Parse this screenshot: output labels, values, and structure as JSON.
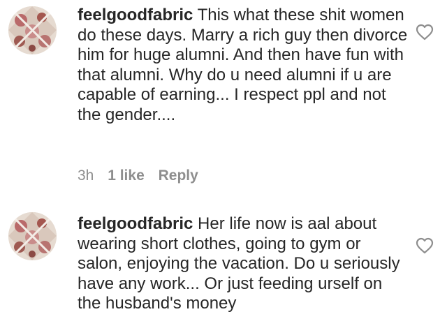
{
  "comments": [
    {
      "username": "feelgoodfabric",
      "text": "This what these shit women do these days. Marry a rich guy then divorce him for huge alumni. And then have fun with that alumni. Why do u need alumni if u are capable of earning... I respect ppl and not the gender....",
      "time": "3h",
      "likes": "1 like",
      "reply_label": "Reply",
      "avatar_icon": "profile-avatar-floral",
      "like_icon": "heart-outline-icon"
    },
    {
      "username": "feelgoodfabric",
      "text": "Her life now is aal about wearing short clothes, going to gym or salon, enjoying the vacation. Do u seriously have any work... Or just feeding urself on the husband's money",
      "avatar_icon": "profile-avatar-floral",
      "like_icon": "heart-outline-icon"
    }
  ],
  "colors": {
    "text": "#262626",
    "meta": "#8e8e8e",
    "heart_stroke": "#8e8e8e"
  }
}
